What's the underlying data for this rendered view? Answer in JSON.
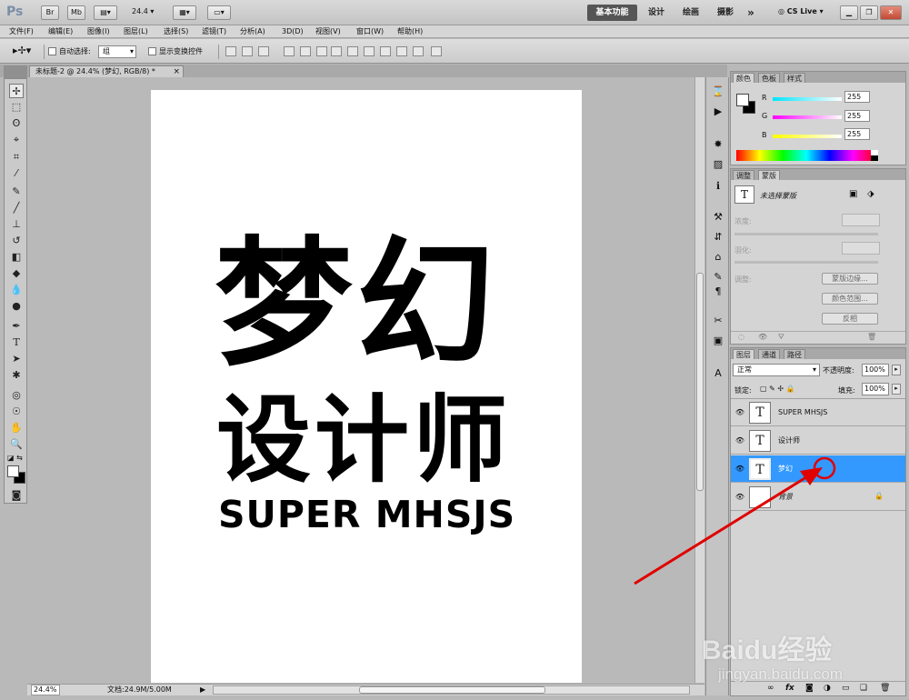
{
  "titlebar": {
    "logo": "Ps",
    "btn_br": "Br",
    "btn_mb": "Mb",
    "zoom": "24.4",
    "workspaces": [
      "基本功能",
      "设计",
      "绘画",
      "摄影"
    ],
    "more": "»",
    "cslive": "CS Live"
  },
  "menubar": [
    "文件(F)",
    "编辑(E)",
    "图像(I)",
    "图层(L)",
    "选择(S)",
    "滤镜(T)",
    "分析(A)",
    "3D(D)",
    "视图(V)",
    "窗口(W)",
    "帮助(H)"
  ],
  "options": {
    "auto_select_label": "自动选择:",
    "auto_select_value": "组",
    "transform_label": "显示变换控件"
  },
  "document": {
    "tab_title": "未标题-2 @ 24.4% (梦幻, RGB/8) *",
    "close": "×",
    "line1": "梦幻",
    "line2": "设计师",
    "line3": "SUPER MHSJS"
  },
  "status": {
    "zoom": "24.4%",
    "doc_info": "文档:24.9M/5.00M"
  },
  "color_panel": {
    "tabs": [
      "颜色",
      "色板",
      "样式"
    ],
    "channels": [
      {
        "label": "R",
        "value": "255",
        "color": "#00e5ff"
      },
      {
        "label": "G",
        "value": "255",
        "color": "#ff00ff"
      },
      {
        "label": "B",
        "value": "255",
        "color": "#ffff00"
      }
    ]
  },
  "masks_panel": {
    "tabs": [
      "调整",
      "蒙版"
    ],
    "no_mask": "未选择蒙版",
    "density": "浓度:",
    "feather": "羽化:",
    "refine": "调整:",
    "btn_edge": "蒙版边缘...",
    "btn_range": "颜色范围...",
    "btn_invert": "反相"
  },
  "layers_panel": {
    "tabs": [
      "图层",
      "通道",
      "路径"
    ],
    "blend_mode": "正常",
    "opacity_label": "不透明度:",
    "opacity_value": "100%",
    "lock_label": "锁定:",
    "fill_label": "填充:",
    "fill_value": "100%",
    "layers": [
      {
        "name": "SUPER MHSJS",
        "type": "text",
        "selected": false
      },
      {
        "name": "设计师",
        "type": "text",
        "selected": false
      },
      {
        "name": "梦幻",
        "type": "text",
        "selected": true
      },
      {
        "name": "背景",
        "type": "background",
        "selected": false
      }
    ],
    "footer_icons": [
      "link-icon",
      "fx-icon",
      "mask-icon",
      "adjustment-icon",
      "folder-icon",
      "new-layer-icon",
      "trash-icon"
    ]
  },
  "annotation": {
    "arrow_color": "#e00000"
  },
  "watermark": {
    "brand": "Baidu经验",
    "url": "jingyan.baidu.com"
  }
}
